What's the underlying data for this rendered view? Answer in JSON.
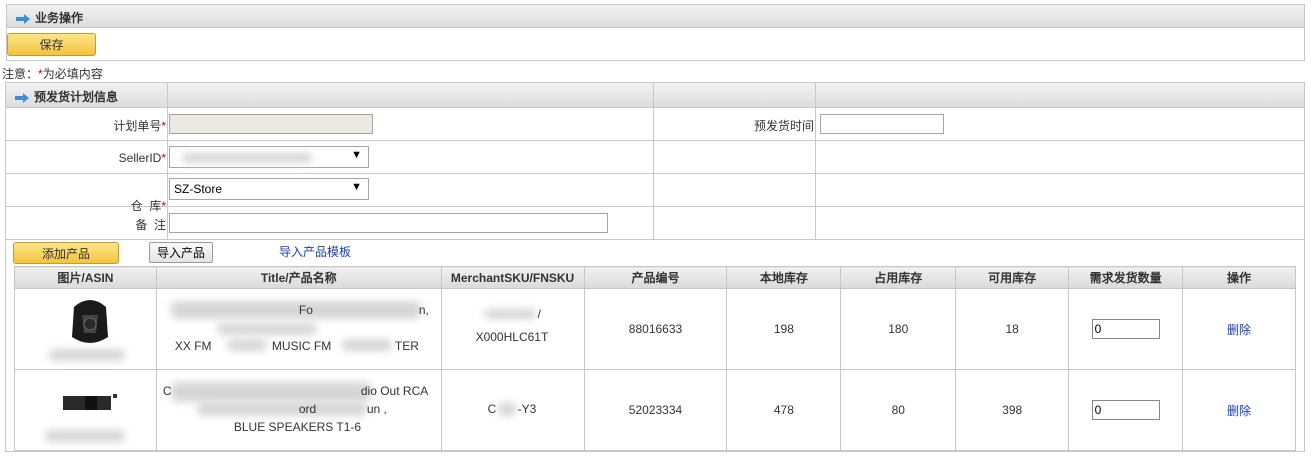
{
  "ops": {
    "title": "业务操作",
    "save_label": "保存"
  },
  "note": {
    "prefix": "注意：",
    "star": "*",
    "text": "为必填内容"
  },
  "plan": {
    "title": "预发货计划信息",
    "plan_no_label": "计划单号",
    "seller_label": "SellerID",
    "warehouse_label": "仓  库",
    "warehouse_value": "SZ-Store",
    "remark_label": "备  注",
    "ship_time_label": "预发货时间",
    "req": "*"
  },
  "actions": {
    "add_label": "添加产品",
    "import_label": "导入产品",
    "template_link": "导入产品模板"
  },
  "table": {
    "headers": [
      "图片/ASIN",
      "Title/产品名称",
      "MerchantSKU/FNSKU",
      "产品编号",
      "本地库存",
      "占用库存",
      "可用库存",
      "需求发货数量",
      "操作"
    ],
    "rows": [
      {
        "title_l1": "Fo",
        "title_l1b": "n,",
        "title_l3a": "XX FM",
        "title_l3b": "MUSIC FM",
        "title_l3c": "TER",
        "sku_l1": "/",
        "fnsku": "X000HLC61T",
        "product_no": "88016633",
        "local_stock": "198",
        "reserved_stock": "180",
        "available_stock": "18",
        "qty": "0",
        "delete_label": "删除"
      },
      {
        "title_l1": "C",
        "title_l1b": "dio Out RCA",
        "title_l2a": "ord",
        "title_l2b": "un ,",
        "title_l3": "BLUE SPEAKERS T1-6",
        "fnsku_a": "C",
        "fnsku_b": "-Y3",
        "product_no": "52023334",
        "local_stock": "478",
        "reserved_stock": "80",
        "available_stock": "398",
        "qty": "0",
        "delete_label": "删除"
      }
    ]
  },
  "colors": {
    "link": "#1a3fb5",
    "required": "#cc0000",
    "button": "#f2c340"
  }
}
